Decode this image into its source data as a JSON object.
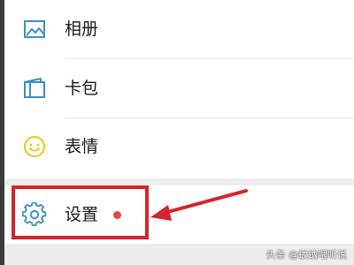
{
  "menu": {
    "items": [
      {
        "label": "相册",
        "icon": "photo-album-icon"
      },
      {
        "label": "卡包",
        "icon": "card-wallet-icon"
      },
      {
        "label": "表情",
        "icon": "emoji-smile-icon"
      }
    ]
  },
  "settings": {
    "label": "设置",
    "icon": "gear-icon",
    "has_notification_dot": true
  },
  "annotation": {
    "box_color": "#d7232b",
    "arrow_color": "#d7232b"
  },
  "colors": {
    "icon_accent": "#3a8fc4",
    "icon_yellow": "#f0c419",
    "notification_dot": "#e5474b"
  },
  "watermark": {
    "text": "头条 @蚊蚋喂听说"
  }
}
